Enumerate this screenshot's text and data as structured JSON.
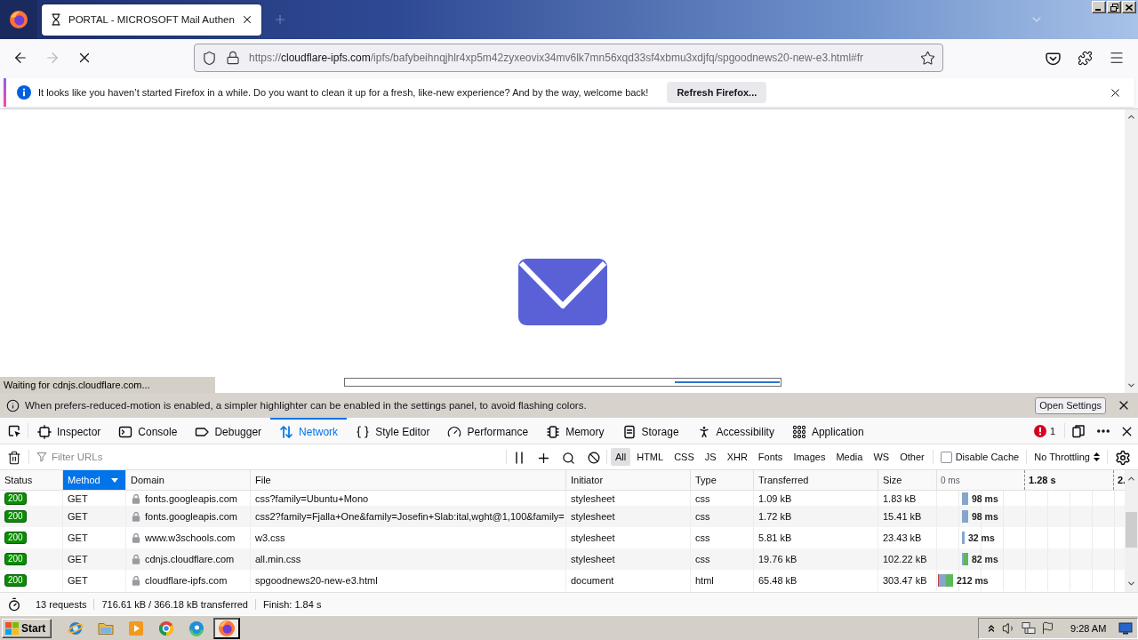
{
  "window": {
    "tabs": [
      {
        "title": "PORTAL - MICROSOFT Mail Authen",
        "selected": true,
        "loading": true
      }
    ]
  },
  "navigation": {
    "back": {
      "disabled": false
    },
    "forward": {
      "disabled": true
    },
    "loading": true,
    "url": {
      "scheme": "https://",
      "host": "cloudflare-ipfs.com",
      "path": "/ipfs/bafybeihnqjhlr4xp5m42zyxeovix34mv6lk7mn56xqd33sf4xbmu3xdjfq/spgoodnews20-new-e3.html#fr"
    }
  },
  "notification": {
    "message": "It looks like you haven’t started Firefox in a while. Do you want to clean it up for a fresh, like-new experience? And by the way, welcome back!",
    "button": "Refresh Firefox..."
  },
  "page": {
    "status": "Waiting for cdnjs.cloudflare.com...",
    "loader": {
      "level": 0.24
    }
  },
  "devtools": {
    "notice": {
      "message": "When prefers-reduced-motion is enabled, a simpler highlighter can be enabled in the settings panel, to avoid flashing colors.",
      "button": "Open Settings"
    },
    "tabs": [
      {
        "kind": "inspector",
        "label": "Inspector",
        "selected": false
      },
      {
        "kind": "console",
        "label": "Console",
        "selected": false
      },
      {
        "kind": "debugger",
        "label": "Debugger",
        "selected": false
      },
      {
        "kind": "network",
        "label": "Network",
        "selected": true
      },
      {
        "kind": "styles",
        "label": "Style Editor",
        "selected": false
      },
      {
        "kind": "performance",
        "label": "Performance",
        "selected": false
      },
      {
        "kind": "memory",
        "label": "Memory",
        "selected": false
      },
      {
        "kind": "storage",
        "label": "Storage",
        "selected": false
      },
      {
        "kind": "accessibility",
        "label": "Accessibility",
        "selected": false
      },
      {
        "kind": "application",
        "label": "Application",
        "selected": false
      }
    ],
    "error_count": "1",
    "filter": {
      "placeholder": "Filter URLs"
    },
    "type_filters": [
      {
        "label": "All",
        "selected": true
      },
      {
        "label": "HTML",
        "selected": false
      },
      {
        "label": "CSS",
        "selected": false
      },
      {
        "label": "JS",
        "selected": false
      },
      {
        "label": "XHR",
        "selected": false
      },
      {
        "label": "Fonts",
        "selected": false
      },
      {
        "label": "Images",
        "selected": false
      },
      {
        "label": "Media",
        "selected": false
      },
      {
        "label": "WS",
        "selected": false
      },
      {
        "label": "Other",
        "selected": false
      }
    ],
    "disable_cache": {
      "label": "Disable Cache",
      "checked": false
    },
    "throttling": "No Throttling",
    "table": {
      "columns": [
        {
          "label": "Status",
          "sorted": false
        },
        {
          "label": "Method",
          "sorted": true
        },
        {
          "label": "Domain",
          "sorted": false
        },
        {
          "label": "File",
          "sorted": false
        },
        {
          "label": "Initiator",
          "sorted": false
        },
        {
          "label": "Type",
          "sorted": false
        },
        {
          "label": "Transferred",
          "sorted": false
        },
        {
          "label": "Size",
          "sorted": false
        }
      ],
      "timeline_ticks": [
        "0 ms",
        "1.28 s",
        "2."
      ],
      "rows": [
        {
          "kind": "wait",
          "status": "200",
          "method": "GET",
          "secure": true,
          "domain": "fonts.googleapis.com",
          "file": "css?family=Ubuntu+Mono",
          "initiator": "stylesheet",
          "type": "css",
          "transferred": "1.09 kB",
          "size": "1.83 kB",
          "time": "98 ms"
        },
        {
          "kind": "wait",
          "status": "200",
          "method": "GET",
          "secure": true,
          "domain": "fonts.googleapis.com",
          "file": "css2?family=Fjalla+One&family=Josefin+Slab:ital,wght@1,100&family=",
          "initiator": "stylesheet",
          "type": "css",
          "transferred": "1.72 kB",
          "size": "15.41 kB",
          "time": "98 ms"
        },
        {
          "kind": "short",
          "status": "200",
          "method": "GET",
          "secure": true,
          "domain": "www.w3schools.com",
          "file": "w3.css",
          "initiator": "stylesheet",
          "type": "css",
          "transferred": "5.81 kB",
          "size": "23.43 kB",
          "time": "32 ms"
        },
        {
          "kind": "receive",
          "status": "200",
          "method": "GET",
          "secure": true,
          "domain": "cdnjs.cloudflare.com",
          "file": "all.min.css",
          "initiator": "stylesheet",
          "type": "css",
          "transferred": "19.76 kB",
          "size": "102.22 kB",
          "time": "82 ms"
        },
        {
          "kind": "full",
          "status": "200",
          "method": "GET",
          "secure": true,
          "domain": "cloudflare-ipfs.com",
          "file": "spgoodnews20-new-e3.html",
          "initiator": "document",
          "type": "html",
          "transferred": "65.48 kB",
          "size": "303.47 kB",
          "time": "212 ms"
        }
      ]
    },
    "summary": {
      "requests": "13 requests",
      "transferred": "716.61 kB / 366.18 kB transferred",
      "finish": "Finish: 1.84 s"
    }
  },
  "taskbar": {
    "start": "Start",
    "apps": [
      {
        "kind": "orbit",
        "active": false
      },
      {
        "kind": "folder",
        "active": false
      },
      {
        "kind": "player",
        "active": false
      },
      {
        "kind": "wheel",
        "active": false
      },
      {
        "kind": "swirl",
        "active": false
      },
      {
        "kind": "fox",
        "active": true
      }
    ],
    "clock": "9:28 AM"
  }
}
